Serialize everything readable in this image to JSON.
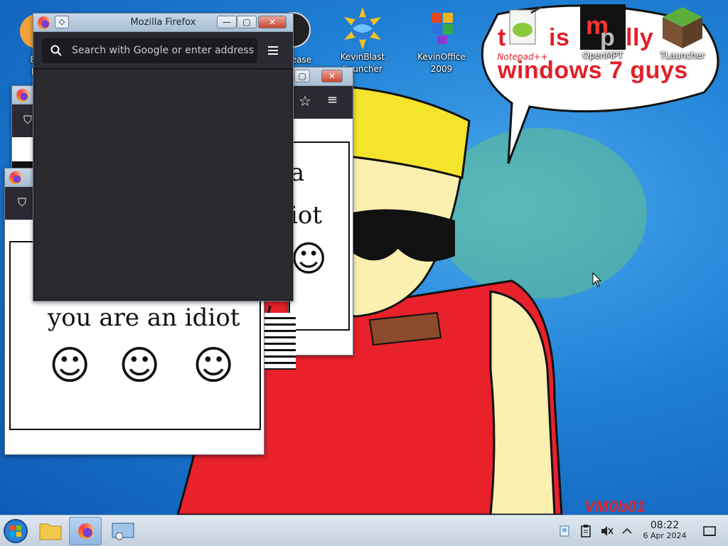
{
  "wallpaper": {
    "speech_line1_a": "t",
    "speech_line1_b": "is",
    "speech_line1_c": "lly",
    "speech_line2": "windows 7 guys",
    "signature": "VM0b01"
  },
  "desktop_icons": [
    {
      "label": "Big",
      "label2": "De",
      "icon": "app-icon"
    },
    {
      "label": "ease",
      "label2": "",
      "icon": "app-icon"
    },
    {
      "label": "KevinBlast",
      "label2": "Launcher",
      "icon": "globe-icon"
    },
    {
      "label": "KevinOffice",
      "label2": "2009",
      "icon": "office-icon"
    },
    {
      "label": "Notepad++",
      "label2": "",
      "icon": "notepad-icon"
    },
    {
      "label": "OpenMPT",
      "label2": "",
      "icon": "openmpt-icon"
    },
    {
      "label": "TLauncher",
      "label2": "",
      "icon": "grass-block-icon"
    }
  ],
  "main_window": {
    "title": "Mozilla Firefox",
    "url_placeholder": "Search with Google or enter address",
    "minimize": "—",
    "maximize": "▢",
    "close": "✕"
  },
  "idiot_window": {
    "text": "you are an idiot",
    "partial_text_1": "a",
    "partial_text_2": "iot",
    "faces": [
      "☺",
      "☺",
      "☺"
    ]
  },
  "taskbar": {
    "time": "08:22",
    "date": "6 Apr 2024",
    "colors": {
      "start_orb": "#2a7fd4",
      "active_task": "#8fb6e2"
    }
  }
}
